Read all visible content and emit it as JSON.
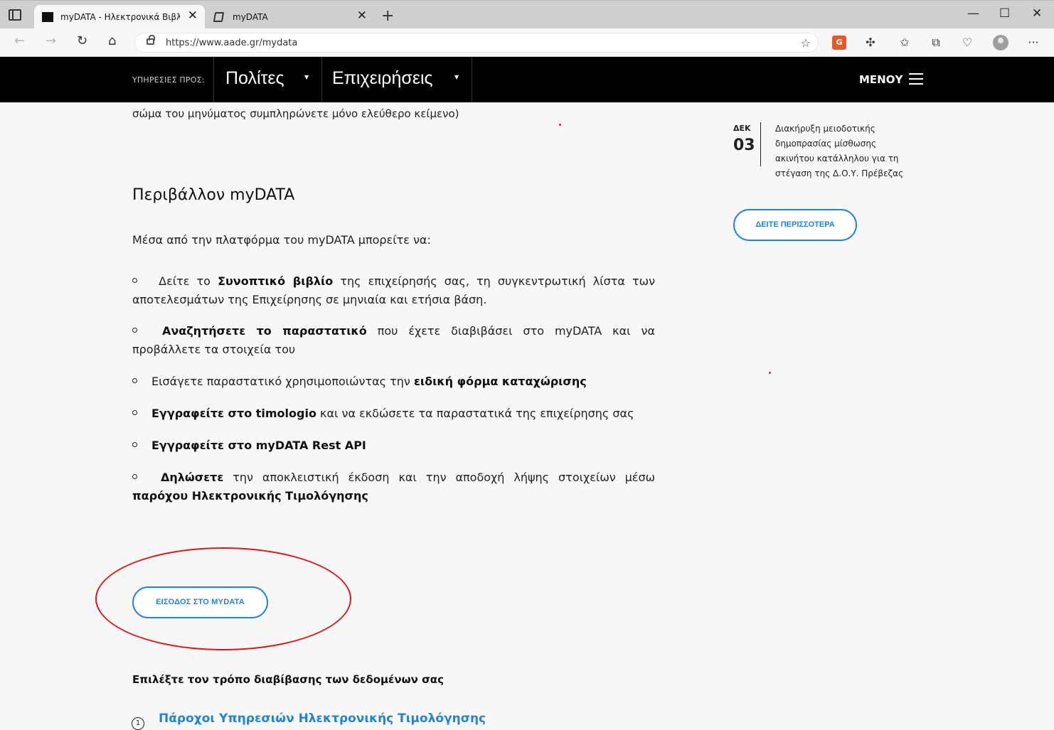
{
  "browser": {
    "tabs": [
      {
        "title": "myDATA - Ηλεκτρονικά Βιβλία ΑΑΔΕ",
        "active": true
      },
      {
        "title": "myDATA",
        "active": false
      }
    ],
    "new_tab": "+",
    "close_glyph": "✕",
    "url": "https://www.aade.gr/mydata",
    "window_controls": {
      "minimize": "—",
      "maximize": "☐",
      "close": "✕"
    },
    "nav": {
      "back": "←",
      "forward": "→",
      "refresh": "↻",
      "home": "⌂"
    },
    "more": "···",
    "ext_g_label": "G"
  },
  "header": {
    "services_label": "ΥΠΗΡΕΣΙΕΣ ΠΡΟΣ:",
    "nav_items": [
      {
        "label": "Πολίτες",
        "caret": "▼"
      },
      {
        "label": "Επιχειρήσεις",
        "caret": "▼"
      }
    ],
    "menu_label": "ΜΕΝΟΥ"
  },
  "main": {
    "partial_text": "σώμα του μηνύματος συμπληρώνετε μόνο ελεύθερο κείμενο)",
    "section_title": "Περιβάλλον myDATA",
    "intro": "Μέσα από την πλατφόρμα του myDATA  μπορείτε να:",
    "bullets": [
      {
        "pre": " Δείτε το ",
        "bold": "Συνοπτικό βιβλίο",
        "post": " της επιχείρησής σας,  τη συγκεντρωτική λίστα των αποτελεσμάτων της Επιχείρησης σε μηνιαία και ετήσια βάση."
      },
      {
        "pre": " ",
        "bold": "Αναζητήσετε το παραστατικό",
        "post": " που έχετε διαβιβάσει στο myDATA και να προβάλλετε τα στοιχεία του"
      },
      {
        "pre": "Εισάγετε παραστατικό χρησιμοποιώντας την ",
        "bold": "ειδική φόρμα καταχώρισης",
        "post": ""
      },
      {
        "pre": "",
        "bold": "Εγγραφείτε στο timologio",
        "post": " και να εκδώσετε τα παραστατικά της επιχείρησης σας"
      },
      {
        "pre": "",
        "bold": "Εγγραφείτε στο myDATA Rest API",
        "post": ""
      },
      {
        "pre": " ",
        "bold": "Δηλώσετε",
        "post": " την αποκλειστική έκδοση και την αποδοχή λήψης στοιχείων μέσω ",
        "bold2": "παρόχου Ηλεκτρονικής Τιμολόγησης"
      }
    ],
    "login_button": "ΕΙΣΟΔΟΣ ΣΤΟ MYDATA",
    "choose_label": "Επιλέξτε τον τρόπο διαβίβασης των δεδομένων σας",
    "providers": [
      {
        "num": "1",
        "label": "Πάροχοι Υπηρεσιών Ηλεκτρονικής Τιμολόγησης"
      }
    ]
  },
  "sidebar": {
    "news": {
      "month": "ΔΕΚ",
      "day": "03",
      "text": "Διακήρυξη μειοδοτικής δημοπρασίας μίσθωσης ακινήτου κατάλληλου για τη στέγαση της Δ.Ο.Υ. Πρέβεζας"
    },
    "more_button": "ΔΕΙΤΕ ΠΕΡΙΣΣΟΤΕΡΑ"
  },
  "colors": {
    "accent": "#2084d8",
    "annotation": "#e01616",
    "header_bg": "#000000"
  }
}
